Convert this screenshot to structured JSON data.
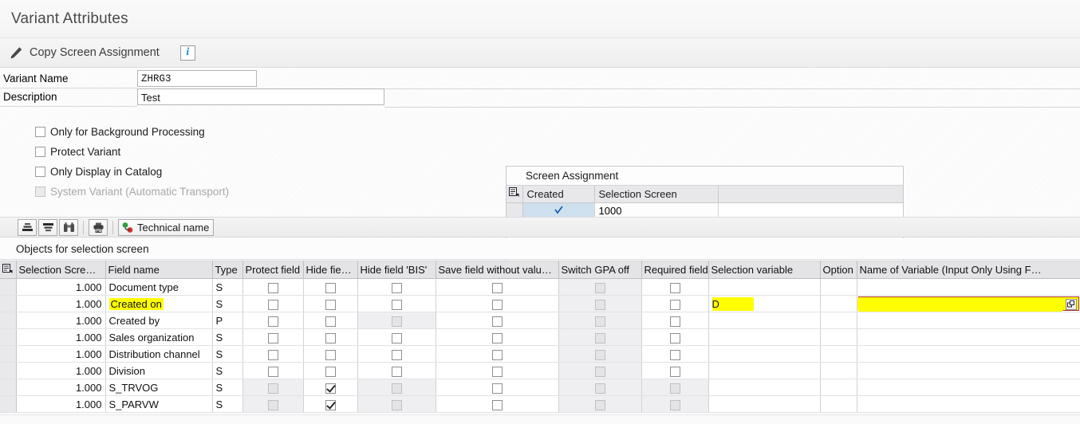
{
  "window": {
    "title": "Variant Attributes"
  },
  "actionbar": {
    "copy_label": "Copy Screen Assignment",
    "pencil_icon": "pencil-icon",
    "info_label": "i",
    "info_icon": "info-icon"
  },
  "form": {
    "variant_name_label": "Variant Name",
    "variant_name_value": "ZHRG3",
    "description_label": "Description",
    "description_value": "Test",
    "checkboxes": [
      {
        "label": "Only for Background Processing",
        "checked": false,
        "disabled": false
      },
      {
        "label": "Protect Variant",
        "checked": false,
        "disabled": false
      },
      {
        "label": "Only Display in Catalog",
        "checked": false,
        "disabled": false
      },
      {
        "label": "System Variant (Automatic Transport)",
        "checked": false,
        "disabled": true
      }
    ]
  },
  "screen_assignment": {
    "title": "Screen Assignment",
    "settings_icon": "table-settings-icon",
    "columns": [
      "Created",
      "Selection Screen"
    ],
    "rows": [
      {
        "created": "✓",
        "selection_screen": "1000"
      }
    ]
  },
  "toolbar": {
    "buttons": [
      {
        "name": "sort-ascending-button",
        "icon": "sort-ascending-icon"
      },
      {
        "name": "sort-descending-button",
        "icon": "sort-descending-icon"
      },
      {
        "name": "find-button",
        "icon": "binoculars-icon"
      },
      {
        "name": "print-button",
        "icon": "printer-icon"
      }
    ],
    "technical_name_label": "Technical name",
    "technical_name_icon": "technical-name-icon"
  },
  "objects_label": "Objects for selection screen",
  "grid": {
    "settings_icon": "table-settings-icon",
    "columns": [
      "Selection Scre…",
      "Field name",
      "Type",
      "Protect field",
      "Hide fie…",
      "Hide field 'BIS'",
      "Save field without valu…",
      "Switch GPA off",
      "Required field",
      "Selection variable",
      "Option",
      "Name of Variable (Input Only Using F…"
    ],
    "rows": [
      {
        "selection_screen": "1.000",
        "field_name": "Document type",
        "field_name_highlighted": false,
        "type": "S",
        "protect_field": {
          "checked": false,
          "disabled": false
        },
        "hide_field": {
          "checked": false,
          "disabled": false
        },
        "hide_field_bis": {
          "checked": false,
          "disabled": false
        },
        "save_field_without_value": {
          "checked": false,
          "disabled": false
        },
        "switch_gpa_off": {
          "checked": false,
          "disabled": true
        },
        "required_field": {
          "checked": false,
          "disabled": false
        },
        "selection_variable": "",
        "selection_variable_highlighted": false,
        "option": "",
        "name_of_variable": "",
        "name_of_variable_focused": false
      },
      {
        "selection_screen": "1.000",
        "field_name": "Created on",
        "field_name_highlighted": true,
        "type": "S",
        "protect_field": {
          "checked": false,
          "disabled": false
        },
        "hide_field": {
          "checked": false,
          "disabled": false
        },
        "hide_field_bis": {
          "checked": false,
          "disabled": false
        },
        "save_field_without_value": {
          "checked": false,
          "disabled": false
        },
        "switch_gpa_off": {
          "checked": false,
          "disabled": true
        },
        "required_field": {
          "checked": false,
          "disabled": false
        },
        "selection_variable": "D",
        "selection_variable_highlighted": true,
        "option": "",
        "name_of_variable": "",
        "name_of_variable_focused": true
      },
      {
        "selection_screen": "1.000",
        "field_name": "Created by",
        "field_name_highlighted": false,
        "type": "P",
        "protect_field": {
          "checked": false,
          "disabled": false
        },
        "hide_field": {
          "checked": false,
          "disabled": false
        },
        "hide_field_bis": {
          "checked": false,
          "disabled": true
        },
        "save_field_without_value": {
          "checked": false,
          "disabled": false
        },
        "switch_gpa_off": {
          "checked": false,
          "disabled": true
        },
        "required_field": {
          "checked": false,
          "disabled": false
        },
        "selection_variable": "",
        "selection_variable_highlighted": false,
        "option": "",
        "name_of_variable": "",
        "name_of_variable_focused": false
      },
      {
        "selection_screen": "1.000",
        "field_name": "Sales organization",
        "field_name_highlighted": false,
        "type": "S",
        "protect_field": {
          "checked": false,
          "disabled": false
        },
        "hide_field": {
          "checked": false,
          "disabled": false
        },
        "hide_field_bis": {
          "checked": false,
          "disabled": false
        },
        "save_field_without_value": {
          "checked": false,
          "disabled": false
        },
        "switch_gpa_off": {
          "checked": false,
          "disabled": true
        },
        "required_field": {
          "checked": false,
          "disabled": false
        },
        "selection_variable": "",
        "selection_variable_highlighted": false,
        "option": "",
        "name_of_variable": "",
        "name_of_variable_focused": false
      },
      {
        "selection_screen": "1.000",
        "field_name": "Distribution channel",
        "field_name_highlighted": false,
        "type": "S",
        "protect_field": {
          "checked": false,
          "disabled": false
        },
        "hide_field": {
          "checked": false,
          "disabled": false
        },
        "hide_field_bis": {
          "checked": false,
          "disabled": false
        },
        "save_field_without_value": {
          "checked": false,
          "disabled": false
        },
        "switch_gpa_off": {
          "checked": false,
          "disabled": true
        },
        "required_field": {
          "checked": false,
          "disabled": false
        },
        "selection_variable": "",
        "selection_variable_highlighted": false,
        "option": "",
        "name_of_variable": "",
        "name_of_variable_focused": false
      },
      {
        "selection_screen": "1.000",
        "field_name": "Division",
        "field_name_highlighted": false,
        "type": "S",
        "protect_field": {
          "checked": false,
          "disabled": false
        },
        "hide_field": {
          "checked": false,
          "disabled": false
        },
        "hide_field_bis": {
          "checked": false,
          "disabled": false
        },
        "save_field_without_value": {
          "checked": false,
          "disabled": false
        },
        "switch_gpa_off": {
          "checked": false,
          "disabled": true
        },
        "required_field": {
          "checked": false,
          "disabled": false
        },
        "selection_variable": "",
        "selection_variable_highlighted": false,
        "option": "",
        "name_of_variable": "",
        "name_of_variable_focused": false
      },
      {
        "selection_screen": "1.000",
        "field_name": "S_TRVOG",
        "field_name_highlighted": false,
        "type": "S",
        "protect_field": {
          "checked": false,
          "disabled": true
        },
        "hide_field": {
          "checked": true,
          "disabled": false
        },
        "hide_field_bis": {
          "checked": false,
          "disabled": true
        },
        "save_field_without_value": {
          "checked": false,
          "disabled": false
        },
        "switch_gpa_off": {
          "checked": false,
          "disabled": true
        },
        "required_field": {
          "checked": false,
          "disabled": true
        },
        "selection_variable": "",
        "selection_variable_highlighted": false,
        "option": "",
        "name_of_variable": "",
        "name_of_variable_focused": false
      },
      {
        "selection_screen": "1.000",
        "field_name": "S_PARVW",
        "field_name_highlighted": false,
        "type": "S",
        "protect_field": {
          "checked": false,
          "disabled": true
        },
        "hide_field": {
          "checked": true,
          "disabled": false
        },
        "hide_field_bis": {
          "checked": false,
          "disabled": true
        },
        "save_field_without_value": {
          "checked": false,
          "disabled": false
        },
        "switch_gpa_off": {
          "checked": false,
          "disabled": true
        },
        "required_field": {
          "checked": false,
          "disabled": true
        },
        "selection_variable": "",
        "selection_variable_highlighted": false,
        "option": "",
        "name_of_variable": "",
        "name_of_variable_focused": false
      }
    ]
  },
  "colors": {
    "highlight": "#ffff00",
    "focus_border": "#a8322a",
    "selected_cell": "#cfe0ef",
    "accent_blue": "#1a8fd1"
  }
}
